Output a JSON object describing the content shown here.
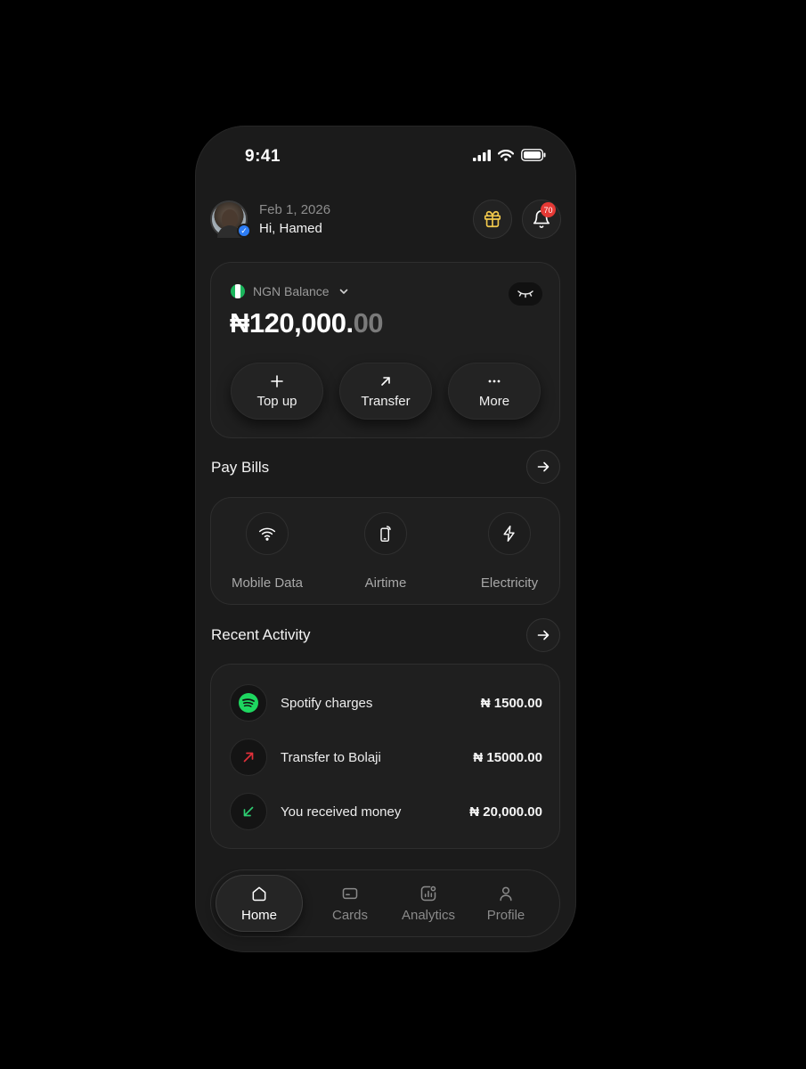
{
  "status_bar": {
    "time": "9:41"
  },
  "header": {
    "date": "Feb 1, 2026",
    "greeting": "Hi, Hamed",
    "notification_count": "70"
  },
  "balance": {
    "label": "NGN Balance",
    "currency_symbol": "₦",
    "amount_whole": "120,000.",
    "amount_decimal": "00",
    "actions": [
      {
        "label": "Top up",
        "icon": "plus-icon"
      },
      {
        "label": "Transfer",
        "icon": "arrow-up-right-icon"
      },
      {
        "label": "More",
        "icon": "ellipsis-icon"
      }
    ]
  },
  "pay_bills": {
    "title": "Pay Bills",
    "items": [
      {
        "label": "Mobile Data",
        "icon": "wifi-icon"
      },
      {
        "label": "Airtime",
        "icon": "phone-signal-icon"
      },
      {
        "label": "Electricity",
        "icon": "lightning-icon"
      }
    ]
  },
  "recent_activity": {
    "title": "Recent Activity",
    "items": [
      {
        "name": "Spotify charges",
        "amount": "₦ 1500.00",
        "icon": "spotify-icon"
      },
      {
        "name": "Transfer to Bolaji",
        "amount": "₦ 15000.00",
        "icon": "outgoing-arrow-icon"
      },
      {
        "name": "You received money",
        "amount": "₦ 20,000.00",
        "icon": "incoming-arrow-icon"
      }
    ]
  },
  "bottom_nav": {
    "items": [
      {
        "label": "Home",
        "icon": "home-icon",
        "active": true
      },
      {
        "label": "Cards",
        "icon": "card-icon"
      },
      {
        "label": "Analytics",
        "icon": "analytics-icon"
      },
      {
        "label": "Profile",
        "icon": "user-icon"
      }
    ]
  },
  "colors": {
    "background": "#000000",
    "surface": "#1b1b1b",
    "accent_gift": "#f2c94c",
    "badge": "#e53935",
    "verified": "#2d7df6",
    "spotify": "#1ed760",
    "outgoing": "#e0303a",
    "incoming": "#2ecc71"
  }
}
